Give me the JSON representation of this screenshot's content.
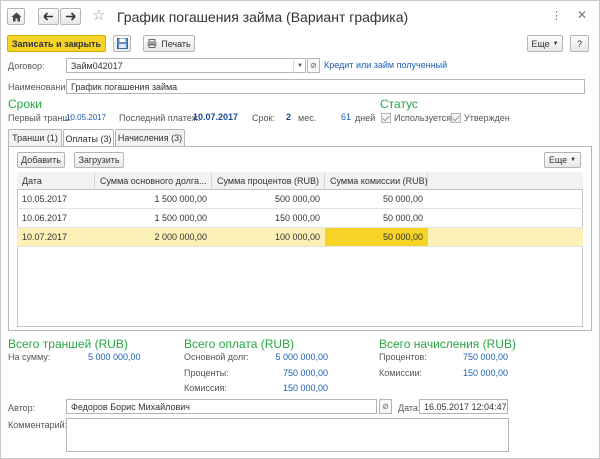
{
  "window": {
    "title": "График погашения займа (Вариант графика)"
  },
  "toolbar": {
    "save_close_label": "Записать и закрыть",
    "print_label": "Печать",
    "more_label": "Еще",
    "help_label": "?"
  },
  "form": {
    "contract_label": "Договор:",
    "contract_value": "Займ042017",
    "contract_link": "Кредит или займ полученный",
    "name_label": "Наименование:",
    "name_value": "График погашения займа"
  },
  "terms": {
    "heading": "Сроки",
    "first_tranche_label": "Первый транш:",
    "first_tranche_value": "10.05.2017",
    "last_payment_label": "Последний платеж:",
    "last_payment_value": "10.07.2017",
    "term_label": "Срок:",
    "term_months": "2",
    "months_unit": "мес.",
    "term_days": "61",
    "days_unit": "дней"
  },
  "status": {
    "heading": "Статус",
    "in_use_label": "Используется",
    "approved_label": "Утвержден"
  },
  "tabs": [
    {
      "label": "Транши (1)"
    },
    {
      "label": "Оплаты (3)"
    },
    {
      "label": "Начисления (3)"
    }
  ],
  "grid_toolbar": {
    "add_label": "Добавить",
    "load_label": "Загрузить",
    "more_label": "Еще"
  },
  "table": {
    "columns": [
      "Дата",
      "Сумма основного долга...",
      "Сумма процентов (RUB)",
      "Сумма комиссии (RUB)"
    ],
    "rows": [
      {
        "date": "10.05.2017",
        "principal": "1 500 000,00",
        "interest": "500 000,00",
        "commission": "50 000,00"
      },
      {
        "date": "10.06.2017",
        "principal": "1 500 000,00",
        "interest": "150 000,00",
        "commission": "50 000,00"
      },
      {
        "date": "10.07.2017",
        "principal": "2 000 000,00",
        "interest": "100 000,00",
        "commission": "50 000,00"
      }
    ]
  },
  "totals": {
    "tranches_heading": "Всего траншей (RUB)",
    "tranches_sum_label": "На сумму:",
    "tranches_sum_value": "5 000 000,00",
    "payments_heading": "Всего оплата (RUB)",
    "principal_label": "Основной долг:",
    "principal_value": "5 000 000,00",
    "interest_label": "Проценты:",
    "interest_value": "750 000,00",
    "commission_label": "Комиссия:",
    "commission_value": "150 000,00",
    "accruals_heading": "Всего начисления (RUB)",
    "accr_interest_label": "Процентов:",
    "accr_interest_value": "750 000,00",
    "accr_commission_label": "Комиссии:",
    "accr_commission_value": "150 000,00"
  },
  "footer": {
    "author_label": "Автор:",
    "author_value": "Федоров Борис Михайлович",
    "date_label": "Дата:",
    "date_value": "16.05.2017 12:04:47",
    "comment_label": "Комментарий:"
  },
  "colors": {
    "accent_yellow": "#f5d327",
    "heading_green": "#27a844",
    "link_blue": "#1a5fb4",
    "row_highlight": "#fbf1b7"
  }
}
